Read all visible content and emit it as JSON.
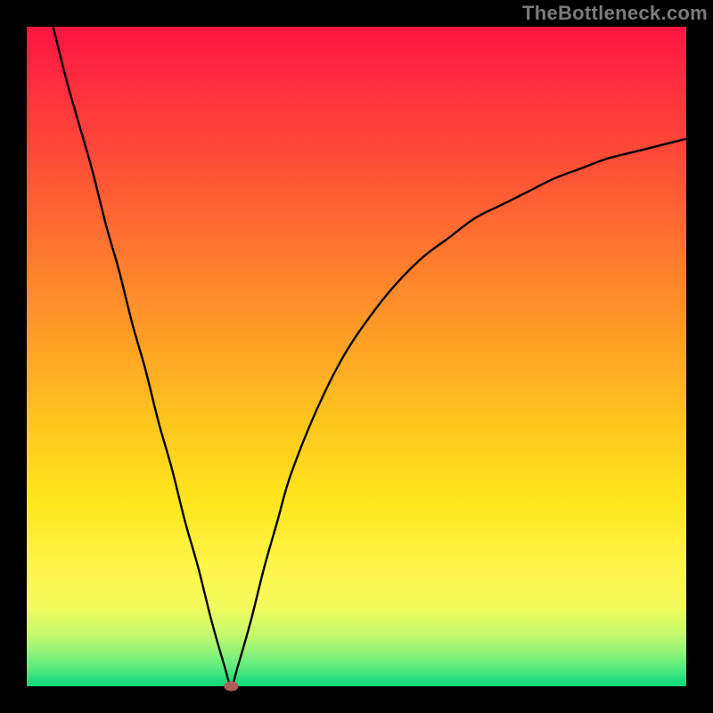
{
  "watermark": "TheBottleneck.com",
  "chart_data": {
    "type": "line",
    "title": "",
    "xlabel": "",
    "ylabel": "",
    "xlim": [
      0,
      100
    ],
    "ylim": [
      0,
      100
    ],
    "background": {
      "gradient": "vertical",
      "stops": [
        {
          "pos": 0.0,
          "color": "#ff1443",
          "meaning": "high-bottleneck"
        },
        {
          "pos": 0.5,
          "color": "#ffa126",
          "meaning": "moderate"
        },
        {
          "pos": 0.8,
          "color": "#fff54a",
          "meaning": "low"
        },
        {
          "pos": 1.0,
          "color": "#18d877",
          "meaning": "optimal"
        }
      ]
    },
    "series": [
      {
        "name": "bottleneck-curve",
        "color": "#000000",
        "x": [
          4,
          6,
          8,
          10,
          12,
          14,
          16,
          18,
          20,
          22,
          24,
          26,
          28,
          30,
          31,
          32,
          34,
          36,
          38,
          40,
          44,
          48,
          52,
          56,
          60,
          64,
          68,
          72,
          76,
          80,
          84,
          88,
          92,
          96,
          100
        ],
        "y": [
          100,
          92,
          85,
          78,
          70,
          63,
          55,
          48,
          40,
          33,
          25,
          18,
          10,
          3,
          0,
          3,
          10,
          18,
          25,
          32,
          42,
          50,
          56,
          61,
          65,
          68,
          71,
          73,
          75,
          77,
          78.5,
          80,
          81,
          82,
          83
        ]
      }
    ],
    "marker": {
      "name": "optimal-point",
      "x": 31,
      "y": 0,
      "color": "#b25d5b"
    }
  }
}
